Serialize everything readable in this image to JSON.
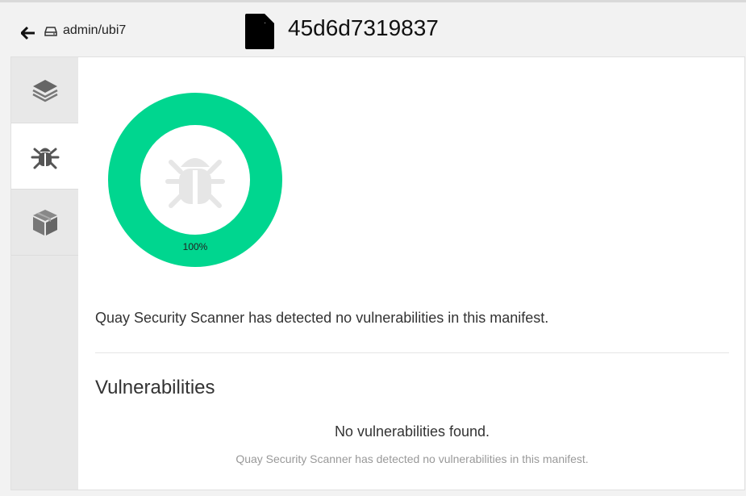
{
  "header": {
    "repository": "admin/ubi7",
    "manifest_id": "45d6d7319837"
  },
  "sidebar": {
    "tabs": [
      {
        "icon": "layers-icon",
        "active": false
      },
      {
        "icon": "bug-icon",
        "active": true
      },
      {
        "icon": "package-icon",
        "active": false
      }
    ]
  },
  "security": {
    "donut_percent_label": "100%",
    "donut_fraction": 1.0,
    "donut_color": "#00d68f",
    "summary": "Quay Security Scanner has detected no vulnerabilities in this manifest.",
    "section_title": "Vulnerabilities",
    "empty_title": "No vulnerabilities found.",
    "empty_subtitle": "Quay Security Scanner has detected no vulnerabilities in this manifest."
  }
}
